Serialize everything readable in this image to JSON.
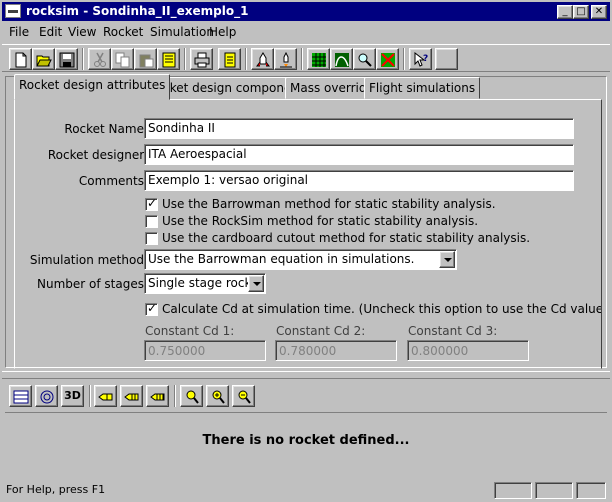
{
  "window": {
    "title": "rocksim - Sondinha_II_exemplo_1",
    "controls": [
      "minimize-icon",
      "maximize-icon",
      "close-icon"
    ]
  },
  "menu": [
    {
      "label": "File"
    },
    {
      "label": "Edit"
    },
    {
      "label": "View"
    },
    {
      "label": "Rocket"
    },
    {
      "label": "Simulation"
    },
    {
      "label": "Help"
    }
  ],
  "toolbar_icons": [
    "new-file-icon",
    "open-folder-icon",
    "save-icon",
    "cut-icon",
    "copy-icon",
    "paste-icon",
    "properties-icon",
    "print-icon",
    "notes-icon",
    "rocket-icon",
    "launch-icon",
    "grid-icon",
    "curve-icon",
    "search-icon",
    "chart-cancel-icon",
    "help-pointer-icon",
    "blank-icon"
  ],
  "tabs": [
    {
      "label": "Rocket design attributes",
      "active": true
    },
    {
      "label": "Rocket design components",
      "active": false
    },
    {
      "label": "Mass override",
      "active": false
    },
    {
      "label": "Flight simulations",
      "active": false
    }
  ],
  "form": {
    "rocket_name_label": "Rocket Name:",
    "rocket_name_value": "Sondinha II",
    "designer_label": "Rocket designer:",
    "designer_value": "ITA Aeroespacial",
    "comments_label": "Comments:",
    "comments_value": "Exemplo 1: versao original",
    "stability_options": [
      {
        "label": "Use the Barrowman method for static stability analysis.",
        "checked": true
      },
      {
        "label": "Use the RockSim method for static stability analysis.",
        "checked": false
      },
      {
        "label": "Use the cardboard cutout method for static stability analysis.",
        "checked": false
      }
    ],
    "simulation_method_label": "Simulation method:",
    "simulation_method_value": "Use the Barrowman equation in simulations.",
    "stages_label": "Number of stages:",
    "stages_value": "Single stage rocket",
    "calc_cd_label": "Calculate Cd at simulation time. (Uncheck this option to use the Cd values below.)",
    "calc_cd_checked": true,
    "constant_cd": [
      {
        "label": "Constant Cd 1:",
        "value": "0.750000"
      },
      {
        "label": "Constant Cd 2:",
        "value": "0.780000"
      },
      {
        "label": "Constant Cd 3:",
        "value": "0.800000"
      }
    ]
  },
  "lower_toolbar_icons": [
    "layout-icon",
    "target-icon",
    "3d-icon",
    "stage-1-icon",
    "stage-2-icon",
    "stage-3-icon",
    "zoom-icon",
    "zoom-in-icon",
    "zoom-out-icon"
  ],
  "lower_toolbar_3d_label": "3D",
  "view_message": "There is no rocket defined...",
  "status": {
    "message": "For Help, press F1"
  },
  "colors": {
    "title_bar": "#000080",
    "face": "#c0c0c0"
  }
}
